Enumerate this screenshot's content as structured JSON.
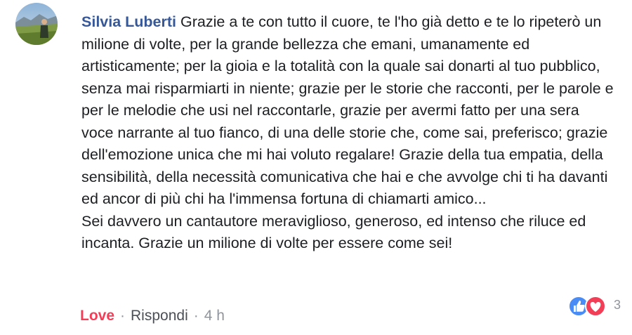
{
  "comment": {
    "author": "Silvia Luberti",
    "first_paragraph": "Grazie a te con tutto il cuore, te l'ho già detto e te lo ripeterò un milione di volte, per la grande bellezza che emani, umanamente ed artisticamente; per la gioia e la totalità con la quale sai donarti al tuo pubblico, senza mai risparmiarti in niente; grazie per le storie che racconti, per le parole e per le melodie che usi nel raccontarle, grazie per avermi fatto per una sera voce narrante al tuo fianco, di una delle storie che, come sai, preferisco; grazie dell'emozione unica che mi hai voluto regalare! Grazie della tua empatia, della sensibilità, della necessità comunicativa che hai e che avvolge chi ti ha davanti ed ancor di più chi ha l'immensa fortuna di chiamarti amico...",
    "second_paragraph": "Sei davvero un cantautore meraviglioso, generoso, ed intenso che riluce ed incanta. Grazie un milione di volte per essere come sei!"
  },
  "actions": {
    "love_label": "Love",
    "reply_label": "Rispondi",
    "separator": "·",
    "time": "4 h"
  },
  "reactions": {
    "icons": [
      "like-icon",
      "love-icon"
    ],
    "count": "3",
    "colors": {
      "like": "#4a8cf6",
      "love": "#f33e58"
    }
  },
  "colors": {
    "author": "#365899",
    "text": "#1c1e21",
    "muted": "#90949c",
    "love_accent": "#f33e58"
  }
}
